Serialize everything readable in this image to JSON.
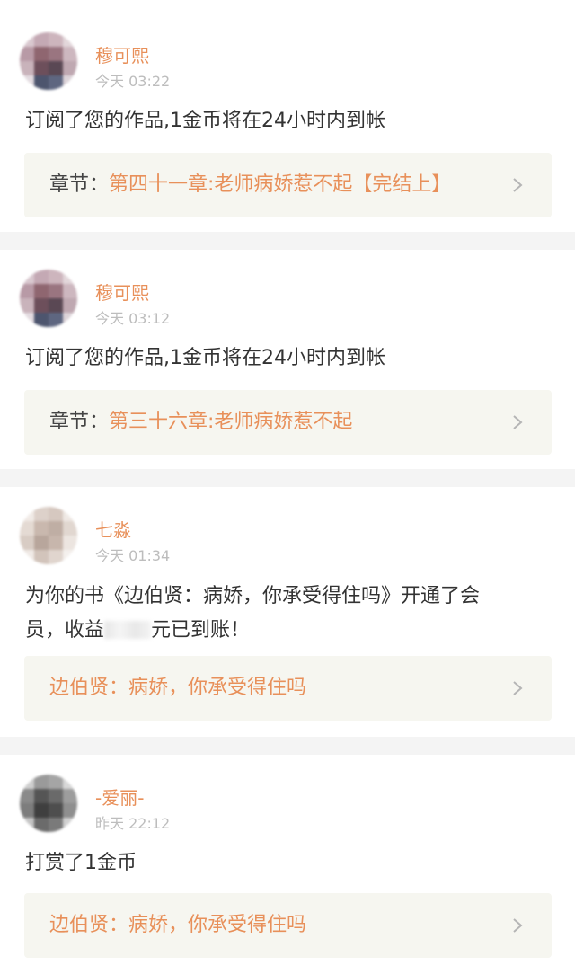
{
  "notifications": [
    {
      "username": "穆可熙",
      "time": "今天 03:22",
      "message": "订阅了您的作品,1金币将在24小时内到帐",
      "link_prefix": "章节：",
      "link_title": "第四十一章:老师病娇惹不起【完结上】"
    },
    {
      "username": "穆可熙",
      "time": "今天 03:12",
      "message": "订阅了您的作品,1金币将在24小时内到帐",
      "link_prefix": "章节：",
      "link_title": "第三十六章:老师病娇惹不起"
    },
    {
      "username": "七淼",
      "time": "今天 01:34",
      "message_line1": "为你的书《边伯贤：病娇，你承受得住吗》开通了会",
      "message_line2_a": "员，收益",
      "message_line2_b": "元已到账！",
      "link_title": "边伯贤：病娇，你承受得住吗"
    },
    {
      "username": "-爱丽-",
      "time": "昨天 22:12",
      "message": "打赏了1金币",
      "link_title": "边伯贤：病娇，你承受得住吗"
    }
  ],
  "icons": {
    "chevron": "chevron-right-icon"
  },
  "colors": {
    "accent": "#e8905a",
    "tab_indicator": "#f0709a",
    "link_box_bg": "#f6f6f0"
  }
}
